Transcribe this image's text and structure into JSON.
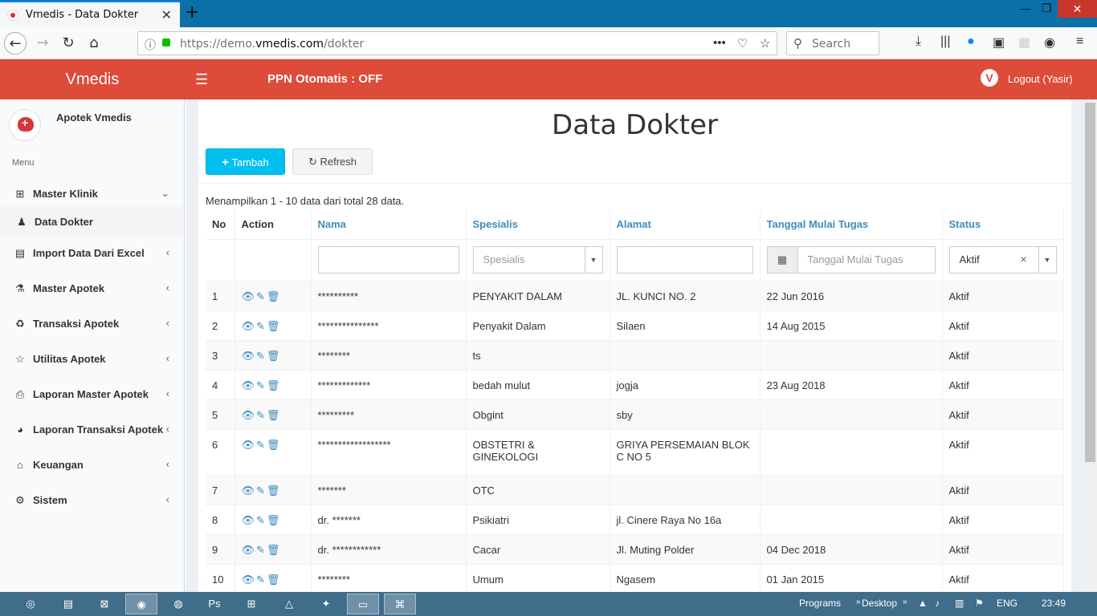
{
  "browser": {
    "tab_title": "Vmedis - Data Dokter",
    "url_prefix": "https://demo.",
    "url_domain": "vmedis.com",
    "url_path": "/dokter",
    "search_placeholder": "Search"
  },
  "header": {
    "brand": "Vmedis",
    "ppn_status": "PPN Otomatis : OFF",
    "logout": "Logout (Yasir)",
    "color": "#dd4b39"
  },
  "sidebar": {
    "org_name": "Apotek Vmedis",
    "menu_label": "Menu",
    "items": [
      {
        "label": "Master Klinik",
        "icon": "plus-square-icon",
        "chevron": "⌄"
      },
      {
        "label": "Data Dokter",
        "icon": "user-md-icon",
        "chevron": ""
      },
      {
        "label": "Import Data Dari Excel",
        "icon": "file-excel-icon",
        "chevron": "‹"
      },
      {
        "label": "Master Apotek",
        "icon": "flask-icon",
        "chevron": "‹"
      },
      {
        "label": "Transaksi Apotek",
        "icon": "recycle-icon",
        "chevron": "‹"
      },
      {
        "label": "Utilitas Apotek",
        "icon": "star-icon",
        "chevron": "‹"
      },
      {
        "label": "Laporan Master Apotek",
        "icon": "print-icon",
        "chevron": "‹"
      },
      {
        "label": "Laporan Transaksi Apotek",
        "icon": "pie-chart-icon",
        "chevron": "‹"
      },
      {
        "label": "Keuangan",
        "icon": "bank-icon",
        "chevron": "‹"
      },
      {
        "label": "Sistem",
        "icon": "cogs-icon",
        "chevron": "‹"
      }
    ]
  },
  "main": {
    "title": "Data Dokter",
    "btn_tambah": "Tambah",
    "btn_refresh": "Refresh",
    "summary": "Menampilkan 1 - 10 data dari total 28 data.",
    "columns": {
      "no": "No",
      "action": "Action",
      "nama": "Nama",
      "spesialis": "Spesialis",
      "alamat": "Alamat",
      "tanggal": "Tanggal Mulai Tugas",
      "status": "Status"
    },
    "filters": {
      "spesialis_placeholder": "Spesialis",
      "tanggal_placeholder": "Tanggal Mulai Tugas",
      "status_value": "Aktif"
    },
    "rows": [
      {
        "no": "1",
        "nama": "**********",
        "spesialis": "PENYAKIT DALAM",
        "alamat": "JL. KUNCI NO. 2",
        "tanggal": "22 Jun 2016",
        "status": "Aktif"
      },
      {
        "no": "2",
        "nama": "***************",
        "spesialis": "Penyakit Dalam",
        "alamat": "Silaen",
        "tanggal": "14 Aug 2015",
        "status": "Aktif"
      },
      {
        "no": "3",
        "nama": "********",
        "spesialis": "ts",
        "alamat": "",
        "tanggal": "",
        "status": "Aktif"
      },
      {
        "no": "4",
        "nama": "*************",
        "spesialis": "bedah mulut",
        "alamat": "jogja",
        "tanggal": "23 Aug 2018",
        "status": "Aktif"
      },
      {
        "no": "5",
        "nama": "*********",
        "spesialis": "Obgint",
        "alamat": "sby",
        "tanggal": "",
        "status": "Aktif"
      },
      {
        "no": "6",
        "nama": "******************",
        "spesialis": "OBSTETRI & GINEKOLOGI",
        "alamat": "GRIYA PERSEMAIAN BLOK C NO 5",
        "tanggal": "",
        "status": "Aktif"
      },
      {
        "no": "7",
        "nama": "*******",
        "spesialis": "OTC",
        "alamat": "",
        "tanggal": "",
        "status": "Aktif"
      },
      {
        "no": "8",
        "nama": "dr. *******",
        "spesialis": "Psikiatri",
        "alamat": "jl. Cinere Raya No 16a",
        "tanggal": "",
        "status": "Aktif"
      },
      {
        "no": "9",
        "nama": "dr. ************",
        "spesialis": "Cacar",
        "alamat": "Jl. Muting Polder",
        "tanggal": "04 Dec 2018",
        "status": "Aktif"
      },
      {
        "no": "10",
        "nama": "********",
        "spesialis": "Umum",
        "alamat": "Ngasem",
        "tanggal": "01 Jan 2015",
        "status": "Aktif"
      }
    ]
  },
  "taskbar": {
    "programs": "Programs",
    "desktop": "Desktop",
    "lang": "ENG",
    "time": "23:49"
  }
}
